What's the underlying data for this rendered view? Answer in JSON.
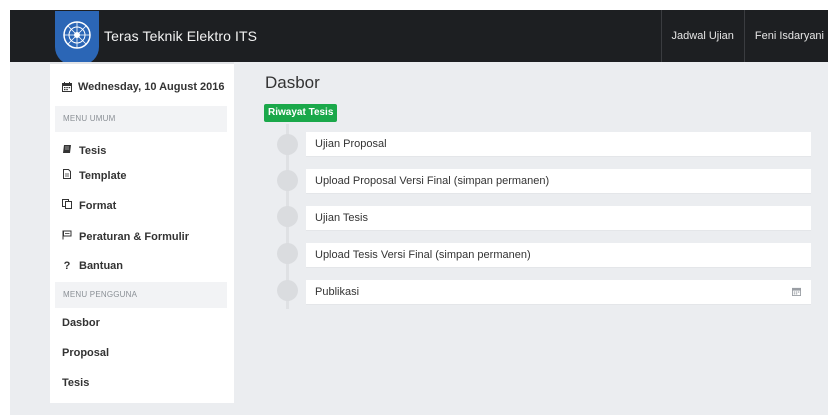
{
  "navbar": {
    "brand": "Teras Teknik Elektro ITS",
    "links": [
      "Jadwal Ujian",
      "Feni Isdaryani"
    ]
  },
  "sidebar": {
    "date": "Wednesday, 10 August 2016",
    "section_general": "MENU UMUM",
    "general_items": [
      {
        "label": "Tesis",
        "icon": "book-icon"
      },
      {
        "label": "Template",
        "icon": "file-icon"
      },
      {
        "label": "Format",
        "icon": "copy-icon"
      },
      {
        "label": "Peraturan & Formulir",
        "icon": "flag-icon"
      },
      {
        "label": "Bantuan",
        "icon": "question-icon"
      }
    ],
    "section_user": "MENU PENGGUNA",
    "user_items": [
      "Dasbor",
      "Proposal",
      "Tesis"
    ]
  },
  "main": {
    "title": "Dasbor",
    "tab": "Riwayat Tesis",
    "timeline": [
      "Ujian Proposal",
      "Upload Proposal Versi Final (simpan permanen)",
      "Ujian Tesis",
      "Upload Tesis Versi Final (simpan permanen)",
      "Publikasi"
    ]
  },
  "colors": {
    "navbar": "#1d1f22",
    "accent_green": "#1aa84a",
    "logo_blue": "#2b66b6",
    "page_bg": "#ebedf0"
  }
}
